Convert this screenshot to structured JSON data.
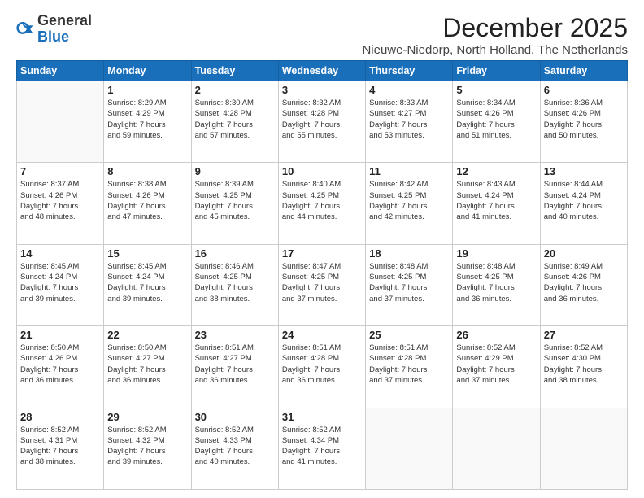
{
  "logo": {
    "general": "General",
    "blue": "Blue"
  },
  "header": {
    "month_title": "December 2025",
    "subtitle": "Nieuwe-Niedorp, North Holland, The Netherlands"
  },
  "weekdays": [
    "Sunday",
    "Monday",
    "Tuesday",
    "Wednesday",
    "Thursday",
    "Friday",
    "Saturday"
  ],
  "weeks": [
    [
      {
        "day": "",
        "info": ""
      },
      {
        "day": "1",
        "info": "Sunrise: 8:29 AM\nSunset: 4:29 PM\nDaylight: 7 hours\nand 59 minutes."
      },
      {
        "day": "2",
        "info": "Sunrise: 8:30 AM\nSunset: 4:28 PM\nDaylight: 7 hours\nand 57 minutes."
      },
      {
        "day": "3",
        "info": "Sunrise: 8:32 AM\nSunset: 4:28 PM\nDaylight: 7 hours\nand 55 minutes."
      },
      {
        "day": "4",
        "info": "Sunrise: 8:33 AM\nSunset: 4:27 PM\nDaylight: 7 hours\nand 53 minutes."
      },
      {
        "day": "5",
        "info": "Sunrise: 8:34 AM\nSunset: 4:26 PM\nDaylight: 7 hours\nand 51 minutes."
      },
      {
        "day": "6",
        "info": "Sunrise: 8:36 AM\nSunset: 4:26 PM\nDaylight: 7 hours\nand 50 minutes."
      }
    ],
    [
      {
        "day": "7",
        "info": "Sunrise: 8:37 AM\nSunset: 4:26 PM\nDaylight: 7 hours\nand 48 minutes."
      },
      {
        "day": "8",
        "info": "Sunrise: 8:38 AM\nSunset: 4:26 PM\nDaylight: 7 hours\nand 47 minutes."
      },
      {
        "day": "9",
        "info": "Sunrise: 8:39 AM\nSunset: 4:25 PM\nDaylight: 7 hours\nand 45 minutes."
      },
      {
        "day": "10",
        "info": "Sunrise: 8:40 AM\nSunset: 4:25 PM\nDaylight: 7 hours\nand 44 minutes."
      },
      {
        "day": "11",
        "info": "Sunrise: 8:42 AM\nSunset: 4:25 PM\nDaylight: 7 hours\nand 42 minutes."
      },
      {
        "day": "12",
        "info": "Sunrise: 8:43 AM\nSunset: 4:24 PM\nDaylight: 7 hours\nand 41 minutes."
      },
      {
        "day": "13",
        "info": "Sunrise: 8:44 AM\nSunset: 4:24 PM\nDaylight: 7 hours\nand 40 minutes."
      }
    ],
    [
      {
        "day": "14",
        "info": "Sunrise: 8:45 AM\nSunset: 4:24 PM\nDaylight: 7 hours\nand 39 minutes."
      },
      {
        "day": "15",
        "info": "Sunrise: 8:45 AM\nSunset: 4:24 PM\nDaylight: 7 hours\nand 39 minutes."
      },
      {
        "day": "16",
        "info": "Sunrise: 8:46 AM\nSunset: 4:25 PM\nDaylight: 7 hours\nand 38 minutes."
      },
      {
        "day": "17",
        "info": "Sunrise: 8:47 AM\nSunset: 4:25 PM\nDaylight: 7 hours\nand 37 minutes."
      },
      {
        "day": "18",
        "info": "Sunrise: 8:48 AM\nSunset: 4:25 PM\nDaylight: 7 hours\nand 37 minutes."
      },
      {
        "day": "19",
        "info": "Sunrise: 8:48 AM\nSunset: 4:25 PM\nDaylight: 7 hours\nand 36 minutes."
      },
      {
        "day": "20",
        "info": "Sunrise: 8:49 AM\nSunset: 4:26 PM\nDaylight: 7 hours\nand 36 minutes."
      }
    ],
    [
      {
        "day": "21",
        "info": "Sunrise: 8:50 AM\nSunset: 4:26 PM\nDaylight: 7 hours\nand 36 minutes."
      },
      {
        "day": "22",
        "info": "Sunrise: 8:50 AM\nSunset: 4:27 PM\nDaylight: 7 hours\nand 36 minutes."
      },
      {
        "day": "23",
        "info": "Sunrise: 8:51 AM\nSunset: 4:27 PM\nDaylight: 7 hours\nand 36 minutes."
      },
      {
        "day": "24",
        "info": "Sunrise: 8:51 AM\nSunset: 4:28 PM\nDaylight: 7 hours\nand 36 minutes."
      },
      {
        "day": "25",
        "info": "Sunrise: 8:51 AM\nSunset: 4:28 PM\nDaylight: 7 hours\nand 37 minutes."
      },
      {
        "day": "26",
        "info": "Sunrise: 8:52 AM\nSunset: 4:29 PM\nDaylight: 7 hours\nand 37 minutes."
      },
      {
        "day": "27",
        "info": "Sunrise: 8:52 AM\nSunset: 4:30 PM\nDaylight: 7 hours\nand 38 minutes."
      }
    ],
    [
      {
        "day": "28",
        "info": "Sunrise: 8:52 AM\nSunset: 4:31 PM\nDaylight: 7 hours\nand 38 minutes."
      },
      {
        "day": "29",
        "info": "Sunrise: 8:52 AM\nSunset: 4:32 PM\nDaylight: 7 hours\nand 39 minutes."
      },
      {
        "day": "30",
        "info": "Sunrise: 8:52 AM\nSunset: 4:33 PM\nDaylight: 7 hours\nand 40 minutes."
      },
      {
        "day": "31",
        "info": "Sunrise: 8:52 AM\nSunset: 4:34 PM\nDaylight: 7 hours\nand 41 minutes."
      },
      {
        "day": "",
        "info": ""
      },
      {
        "day": "",
        "info": ""
      },
      {
        "day": "",
        "info": ""
      }
    ]
  ]
}
